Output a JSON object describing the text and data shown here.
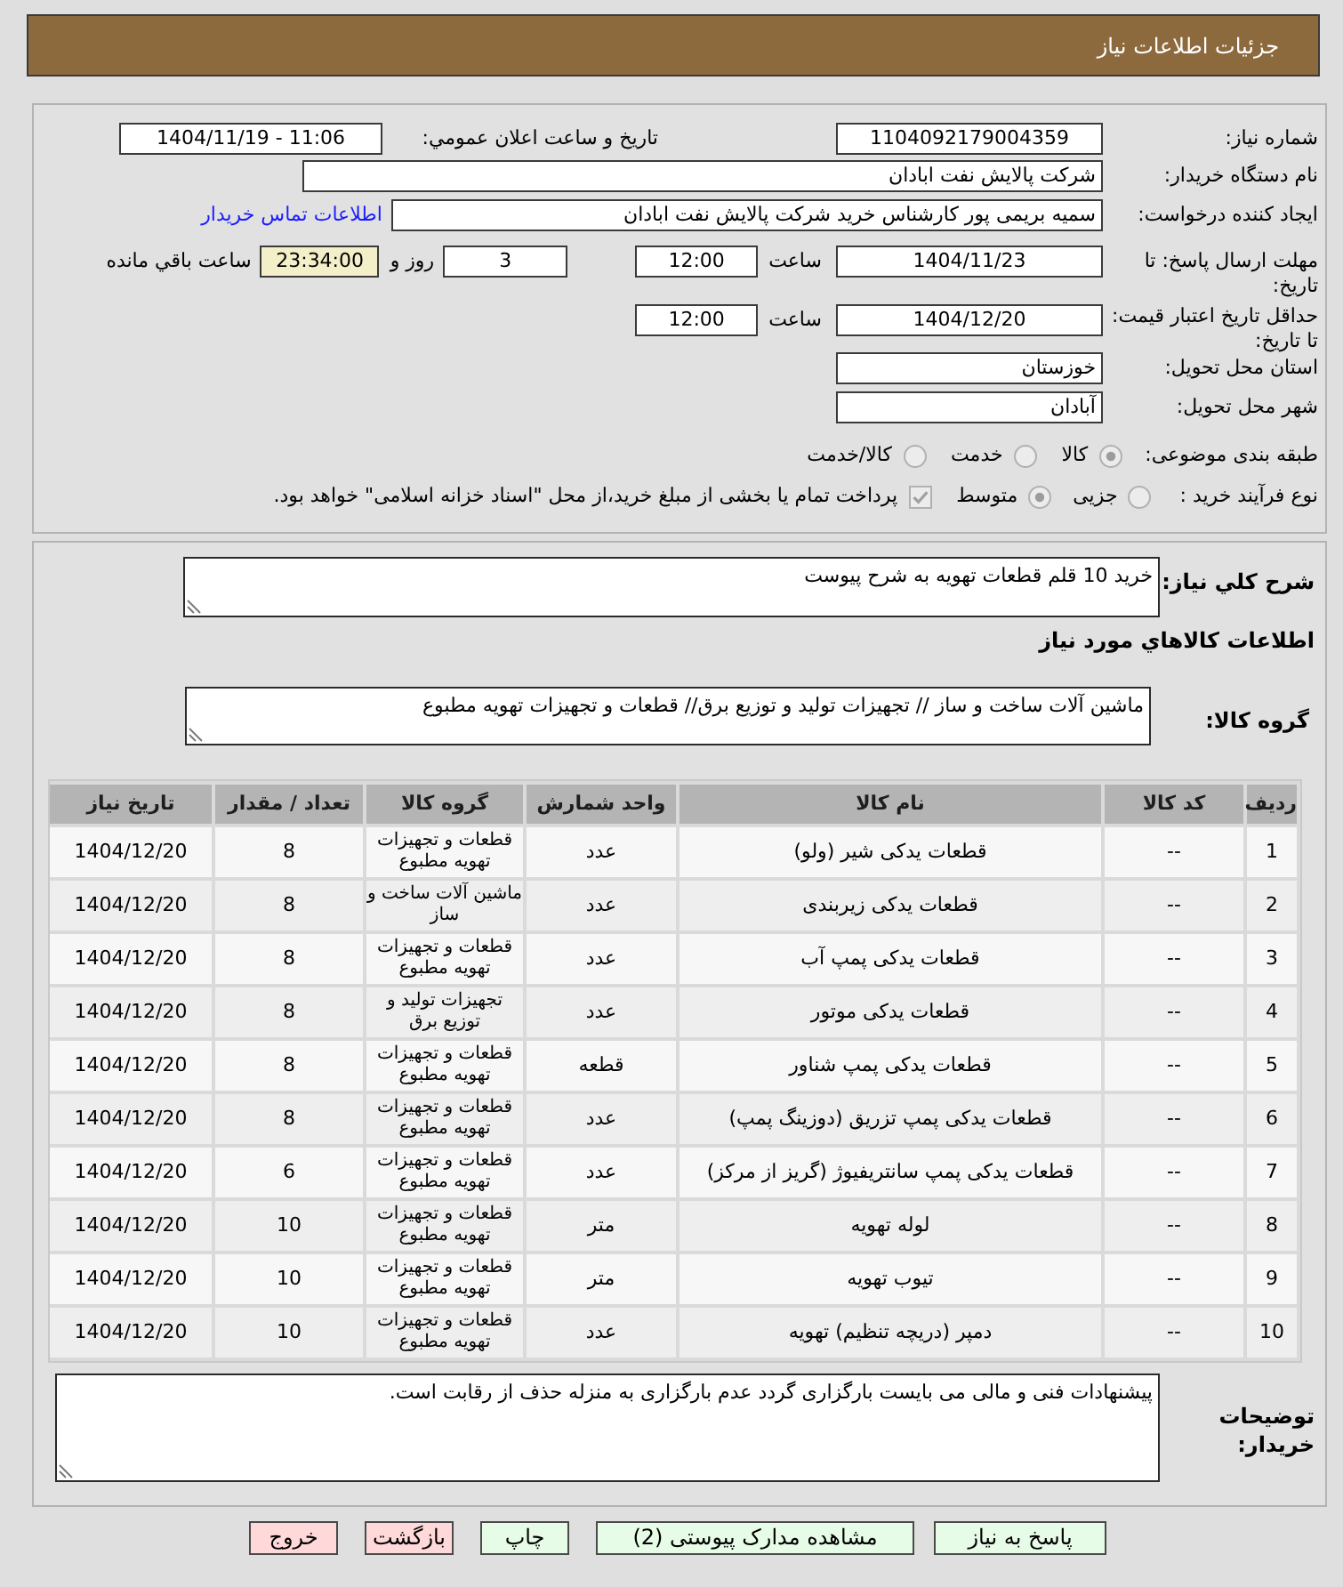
{
  "header": {
    "title": "جزئیات اطلاعات نیاز"
  },
  "details": {
    "need_number": {
      "label": "شماره نیاز:",
      "value": "1104092179004359"
    },
    "announcement": {
      "label": "تاریخ و ساعت اعلان عمومي:",
      "value": "1404/11/19 - 11:06"
    },
    "buyer_org": {
      "label": "نام دستگاه خریدار:",
      "value": "شرکت پالایش نفت ابادان"
    },
    "requester": {
      "label": "ایجاد کننده درخواست:",
      "value": "سمیه بریمی پور کارشناس خرید شرکت پالایش نفت ابادان",
      "contact_link": "اطلاعات تماس خریدار"
    },
    "response_deadline": {
      "label": "مهلت ارسال پاسخ: تا تاریخ:",
      "date": "1404/11/23",
      "time_label": "ساعت",
      "time": "12:00",
      "days": "3",
      "days_label": "روز و",
      "remaining": "23:34:00",
      "remaining_label": "ساعت باقي مانده"
    },
    "price_validity": {
      "label": "حداقل تاریخ اعتبار قیمت: تا تاریخ:",
      "date": "1404/12/20",
      "time_label": "ساعت",
      "time": "12:00"
    },
    "province": {
      "label": "استان محل تحویل:",
      "value": "خوزستان"
    },
    "city": {
      "label": "شهر محل تحویل:",
      "value": "آبادان"
    },
    "category": {
      "label": "طبقه بندی موضوعی:",
      "options": [
        {
          "label": "کالا",
          "selected": true,
          "disabled": true
        },
        {
          "label": "خدمت",
          "selected": false,
          "disabled": true
        },
        {
          "label": "کالا/خدمت",
          "selected": false,
          "disabled": true
        }
      ]
    },
    "process": {
      "label": "نوع فرآیند خرید :",
      "options": [
        {
          "label": "جزیی",
          "selected": false,
          "disabled": true
        },
        {
          "label": "متوسط",
          "selected": true,
          "disabled": true
        }
      ],
      "treasury": {
        "label": "پرداخت تمام یا بخشی از مبلغ خرید،از محل \"اسناد خزانه اسلامی\" خواهد بود.",
        "checked": true,
        "disabled": true
      }
    }
  },
  "description": {
    "label": "شرح کلي نیاز:",
    "value": "خرید 10 قلم قطعات تهویه به شرح پیوست"
  },
  "goods": {
    "title": "اطلاعات کالاهاي مورد نياز",
    "group_label": "گروه کالا:",
    "group_value": "ماشین آلات ساخت و ساز // تجهیزات تولید و توزیع برق// قطعات و تجهیزات تهویه مطبوع"
  },
  "table": {
    "columns": [
      "ردیف",
      "کد کالا",
      "نام کالا",
      "واحد شمارش",
      "گروه کالا",
      "تعداد / مقدار",
      "تاریخ نیاز"
    ],
    "rows": [
      [
        "1",
        "--",
        "قطعات یدکی شیر (ولو)",
        "عدد",
        "قطعات و تجهیزات تهویه مطبوع",
        "8",
        "1404/12/20"
      ],
      [
        "2",
        "--",
        "قطعات یدکی زیربندی",
        "عدد",
        "ماشین آلات ساخت و ساز",
        "8",
        "1404/12/20"
      ],
      [
        "3",
        "--",
        "قطعات یدکی پمپ آب",
        "عدد",
        "قطعات و تجهیزات تهویه مطبوع",
        "8",
        "1404/12/20"
      ],
      [
        "4",
        "--",
        "قطعات یدکی موتور",
        "عدد",
        "تجهیزات تولید و توزیع برق",
        "8",
        "1404/12/20"
      ],
      [
        "5",
        "--",
        "قطعات یدکی پمپ شناور",
        "قطعه",
        "قطعات و تجهیزات تهویه مطبوع",
        "8",
        "1404/12/20"
      ],
      [
        "6",
        "--",
        "قطعات یدکی پمپ تزریق (دوزینگ پمپ)",
        "عدد",
        "قطعات و تجهیزات تهویه مطبوع",
        "8",
        "1404/12/20"
      ],
      [
        "7",
        "--",
        "قطعات یدکی پمپ سانتریفیوژ (گریز از مرکز)",
        "عدد",
        "قطعات و تجهیزات تهویه مطبوع",
        "6",
        "1404/12/20"
      ],
      [
        "8",
        "--",
        "لوله تهویه",
        "متر",
        "قطعات و تجهیزات تهویه مطبوع",
        "10",
        "1404/12/20"
      ],
      [
        "9",
        "--",
        "تیوب تهویه",
        "متر",
        "قطعات و تجهیزات تهویه مطبوع",
        "10",
        "1404/12/20"
      ],
      [
        "10",
        "--",
        "دمپر (دریچه تنظیم) تهویه",
        "عدد",
        "قطعات و تجهیزات تهویه مطبوع",
        "10",
        "1404/12/20"
      ]
    ]
  },
  "buyer_notes": {
    "label": "توضیحات خریدار:",
    "value": "پیشنهادات فنی و مالی می بایست بارگزاری گردد عدم بارگزاری به منزله حذف از رقابت است."
  },
  "buttons": [
    {
      "label": "پاسخ به نیاز",
      "kind": "primary"
    },
    {
      "label": "مشاهده مدارک پیوستی (2)",
      "kind": "primary"
    },
    {
      "label": "چاپ",
      "kind": "primary"
    },
    {
      "label": "بازگشت",
      "kind": "danger"
    },
    {
      "label": "خروج",
      "kind": "danger"
    }
  ]
}
